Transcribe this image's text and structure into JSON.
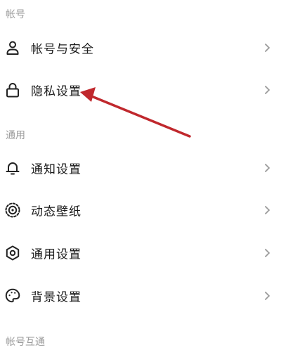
{
  "sections": [
    {
      "title": "帐号",
      "items": [
        {
          "label": "帐号与安全",
          "icon": "person-icon"
        },
        {
          "label": "隐私设置",
          "icon": "lock-icon"
        }
      ]
    },
    {
      "title": "通用",
      "items": [
        {
          "label": "通知设置",
          "icon": "bell-icon"
        },
        {
          "label": "动态壁纸",
          "icon": "dynamic-wallpaper-icon"
        },
        {
          "label": "通用设置",
          "icon": "gear-icon"
        },
        {
          "label": "背景设置",
          "icon": "palette-icon"
        }
      ]
    },
    {
      "title": "帐号互通",
      "items": []
    }
  ],
  "annotation": {
    "arrow_color": "#c0282d",
    "arrow_target": "隐私设置"
  },
  "colors": {
    "section_header": "#9a9a9a",
    "label": "#1a1a1a",
    "chevron": "#9a9a9a",
    "icon": "#222222"
  }
}
